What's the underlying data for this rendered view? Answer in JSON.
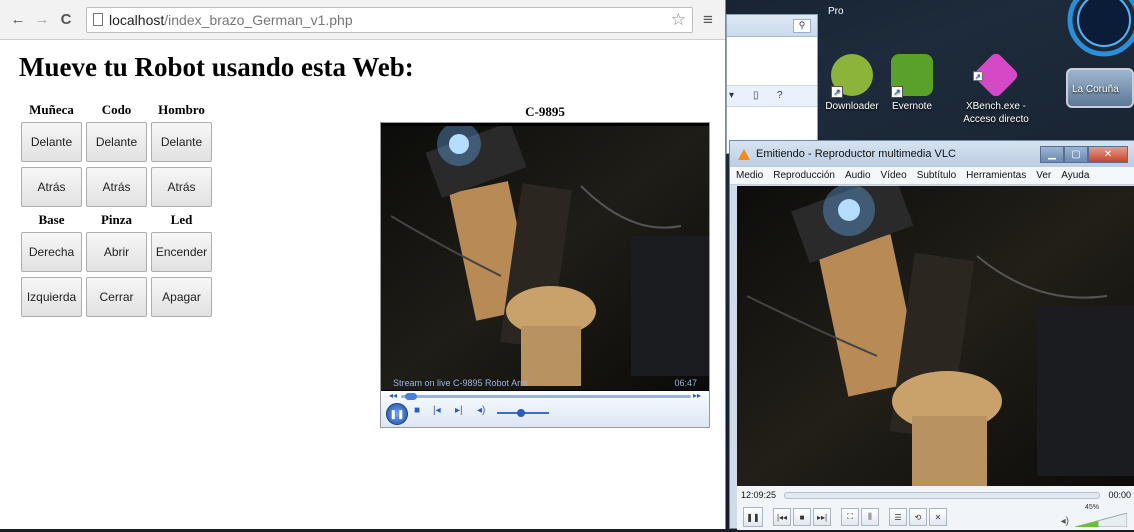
{
  "desktop": {
    "top_label": "Pro",
    "icons": [
      {
        "label": "Downloader",
        "icon": "downloader-icon",
        "color": "#8db43a"
      },
      {
        "label": "Evernote",
        "icon": "evernote-icon",
        "color": "#5aa12c"
      },
      {
        "label": "XBench.exe - Acceso directo",
        "icon": "xbench-icon",
        "color": "#d548c6"
      },
      {
        "label": "La Coruña",
        "icon": "la-coruna-thumbnail",
        "color": "#7a8fa5"
      }
    ]
  },
  "browser": {
    "url_host": "localhost",
    "url_path": "/index_brazo_German_v1.php",
    "page": {
      "heading": "Mueve tu Robot usando esta Web:",
      "group1": {
        "headers": [
          "Muñeca",
          "Codo",
          "Hombro"
        ],
        "row1": [
          "Delante",
          "Delante",
          "Delante"
        ],
        "row2": [
          "Atrás",
          "Atrás",
          "Atrás"
        ]
      },
      "group2": {
        "headers": [
          "Base",
          "Pinza",
          "Led"
        ],
        "row1": [
          "Derecha",
          "Abrir",
          "Encender"
        ],
        "row2": [
          "Izquierda",
          "Cerrar",
          "Apagar"
        ]
      },
      "player": {
        "title": "C-9895",
        "caption": "Stream on live C-9895 Robot Arm",
        "time": "06:47",
        "accent": "#2d5db7"
      }
    }
  },
  "vlc": {
    "title": "Emitiendo - Reproductor multimedia VLC",
    "menu": [
      "Medio",
      "Reproducción",
      "Audio",
      "Vídeo",
      "Subtítulo",
      "Herramientas",
      "Ver",
      "Ayuda"
    ],
    "elapsed": "12:09:25",
    "remaining": "00:00",
    "volume": "45%",
    "volume_level": 0.45
  }
}
